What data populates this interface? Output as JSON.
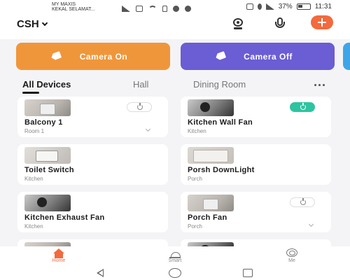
{
  "status_bar": {
    "carrier_line1": "MY MAXIS",
    "carrier_line2": "KEKAL SELAMAT...",
    "battery": "37%",
    "time": "11:31"
  },
  "header": {
    "home_name": "CSH",
    "icons": [
      "camera-icon",
      "microphone-icon",
      "add-icon"
    ],
    "accent": "#f26a3d"
  },
  "scenes": [
    {
      "label": "Camera On",
      "color": "#f0963a"
    },
    {
      "label": "Camera Off",
      "color": "#6b5dd4"
    }
  ],
  "tabs": [
    "All Devices",
    "Hall",
    "Dining Room"
  ],
  "active_tab": "All Devices",
  "devices": [
    {
      "name": "Balcony 1",
      "room": "Room 1",
      "power": "off",
      "image": "wall-switch"
    },
    {
      "name": "Kitchen Wall Fan",
      "room": "Kitchen",
      "power": "on",
      "image": "wall-fan"
    },
    {
      "name": "Toilet Switch",
      "room": "Kitchen",
      "power": "none",
      "image": "wall-switch"
    },
    {
      "name": "Porsh DownLight",
      "room": "Porch",
      "power": "none",
      "image": "downlight"
    },
    {
      "name": "Kitchen Exhaust Fan",
      "room": "Kitchen",
      "power": "none",
      "image": "socket"
    },
    {
      "name": "Porch Fan",
      "room": "Porch",
      "power": "off",
      "image": "wall-switch"
    }
  ],
  "bottom_nav": [
    {
      "label": "Home",
      "active": true
    },
    {
      "label": "Smart",
      "active": false
    },
    {
      "label": "Me",
      "active": false
    }
  ]
}
